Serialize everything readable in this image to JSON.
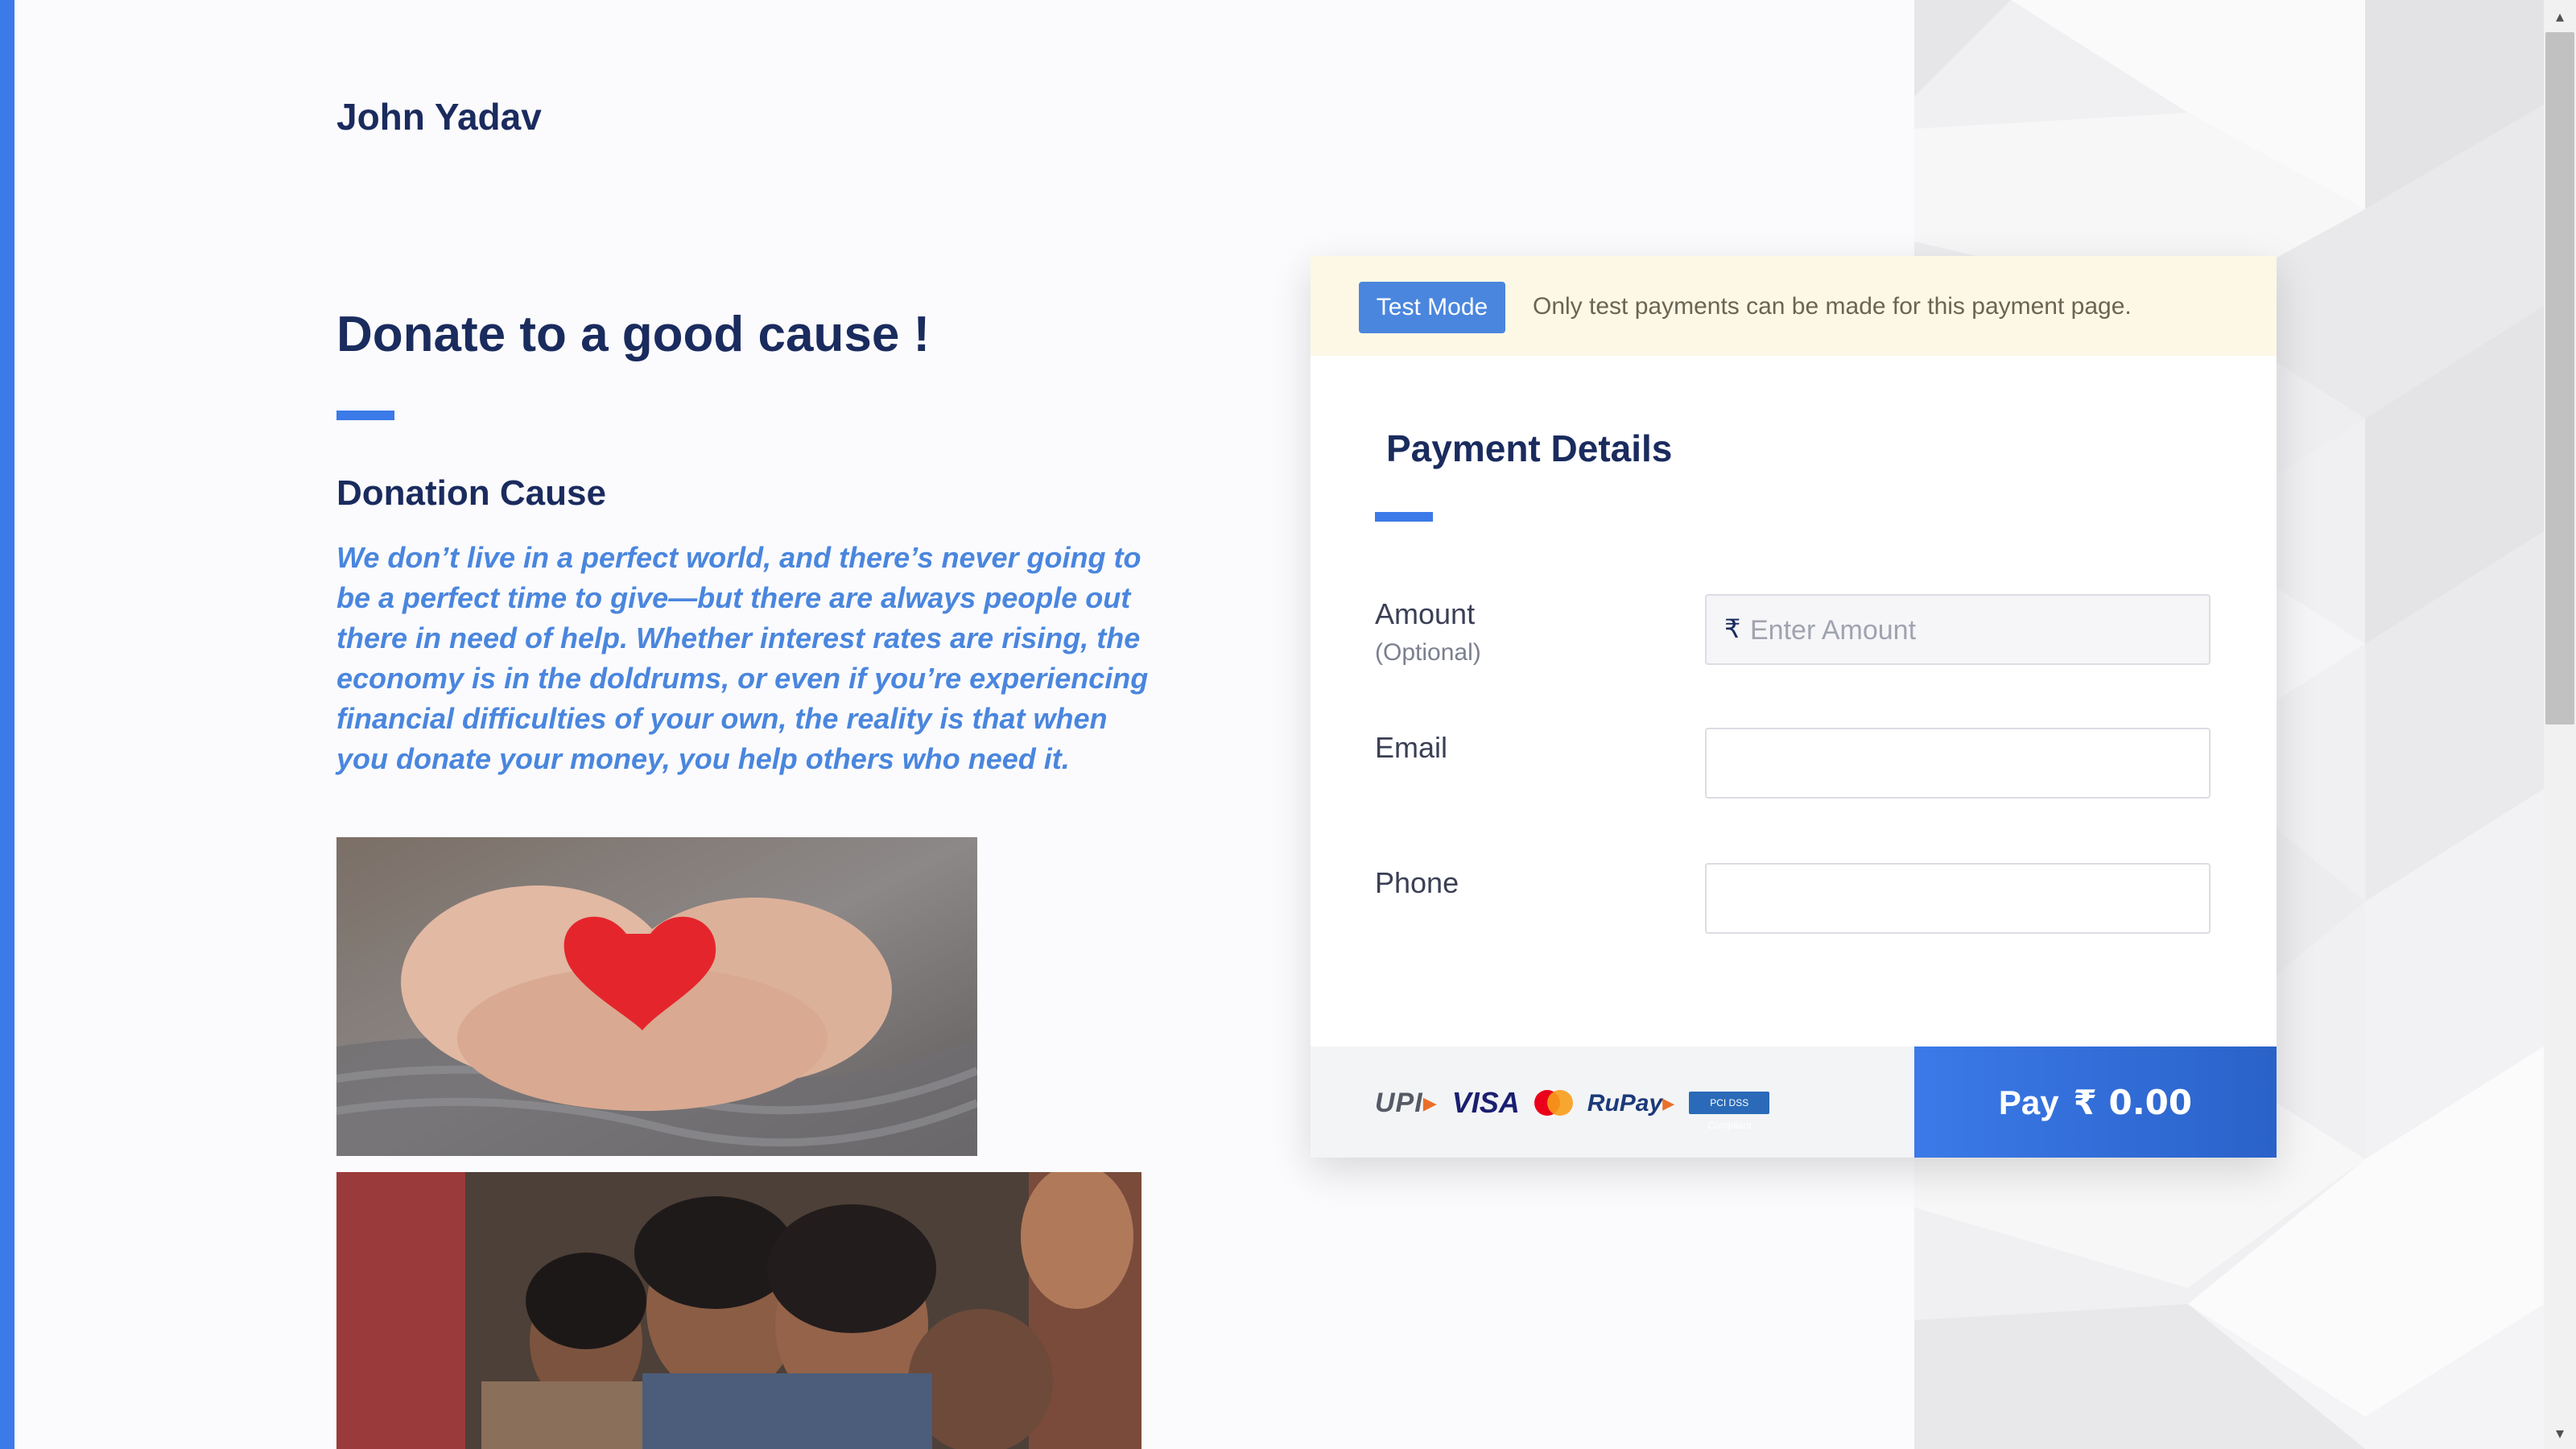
{
  "merchant": {
    "name": "John Yadav"
  },
  "page": {
    "title": "Donate to a good cause !",
    "cause_heading": "Donation Cause",
    "cause_text": "We don’t live in a perfect world, and there’s never going to be a perfect time to give—but there are always people out there in need of help. Whether interest rates are rising, the economy is in the doldrums, or even if you’re experiencing financial difficulties of your own, the reality is that when you donate your money, you help others who need it.",
    "images": [
      {
        "icon": "heart-in-hands-photo"
      },
      {
        "icon": "children-photo"
      }
    ]
  },
  "payment": {
    "test_mode": {
      "badge": "Test Mode",
      "message": "Only test payments can be made for this payment page."
    },
    "title": "Payment Details",
    "fields": {
      "amount": {
        "label": "Amount",
        "sublabel": "(Optional)",
        "currency_symbol": "₹",
        "placeholder": "Enter Amount",
        "value": ""
      },
      "email": {
        "label": "Email",
        "value": ""
      },
      "phone": {
        "label": "Phone",
        "value": ""
      }
    },
    "methods": {
      "upi": "UPI",
      "visa": "VISA",
      "mastercard": "mastercard-icon",
      "rupay": "RuPay",
      "pci": "PCI DSS Compliant"
    },
    "pay_button": {
      "label": "Pay",
      "amount": "₹ 0.00"
    }
  },
  "colors": {
    "accent": "#3b7ae8",
    "heading": "#1a2b5e",
    "cause_text": "#4a86de",
    "banner_bg": "#fdf8e6"
  }
}
